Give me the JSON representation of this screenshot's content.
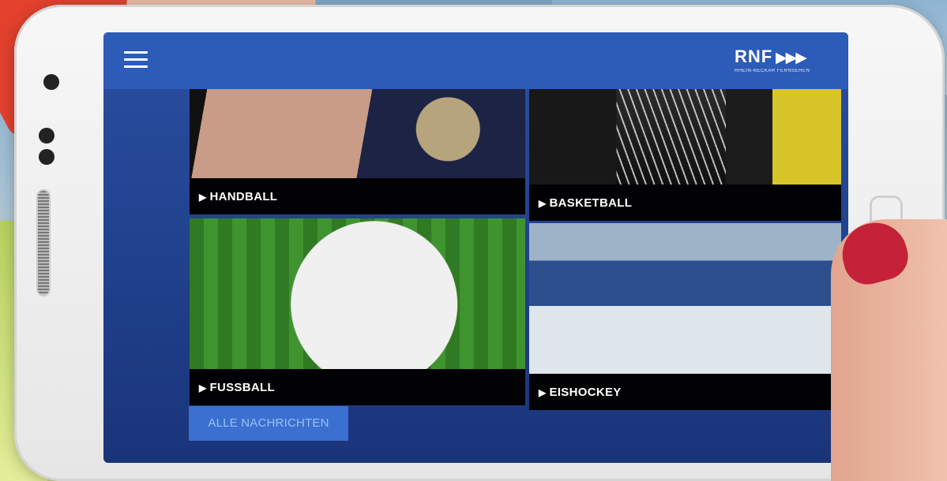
{
  "header": {
    "menu_icon": "hamburger-menu-icon",
    "logo_text": "RNF",
    "logo_arrows": "▶▶▶",
    "logo_subtitle": "RHEIN-NECKAR FERNSEHEN"
  },
  "tiles": [
    {
      "label": "HANDBALL",
      "icon": "play-triangle-icon"
    },
    {
      "label": "BASKETBALL",
      "icon": "play-triangle-icon"
    },
    {
      "label": "FUSSBALL",
      "icon": "play-triangle-icon"
    },
    {
      "label": "EISHOCKEY",
      "icon": "play-triangle-icon"
    }
  ],
  "all_news_button": "ALLE NACHRICHTEN",
  "colors": {
    "header_blue": "#2c5bb8",
    "screen_blue": "#1f3f8a",
    "button_blue": "#3b6fd0",
    "label_bar": "#020205"
  }
}
